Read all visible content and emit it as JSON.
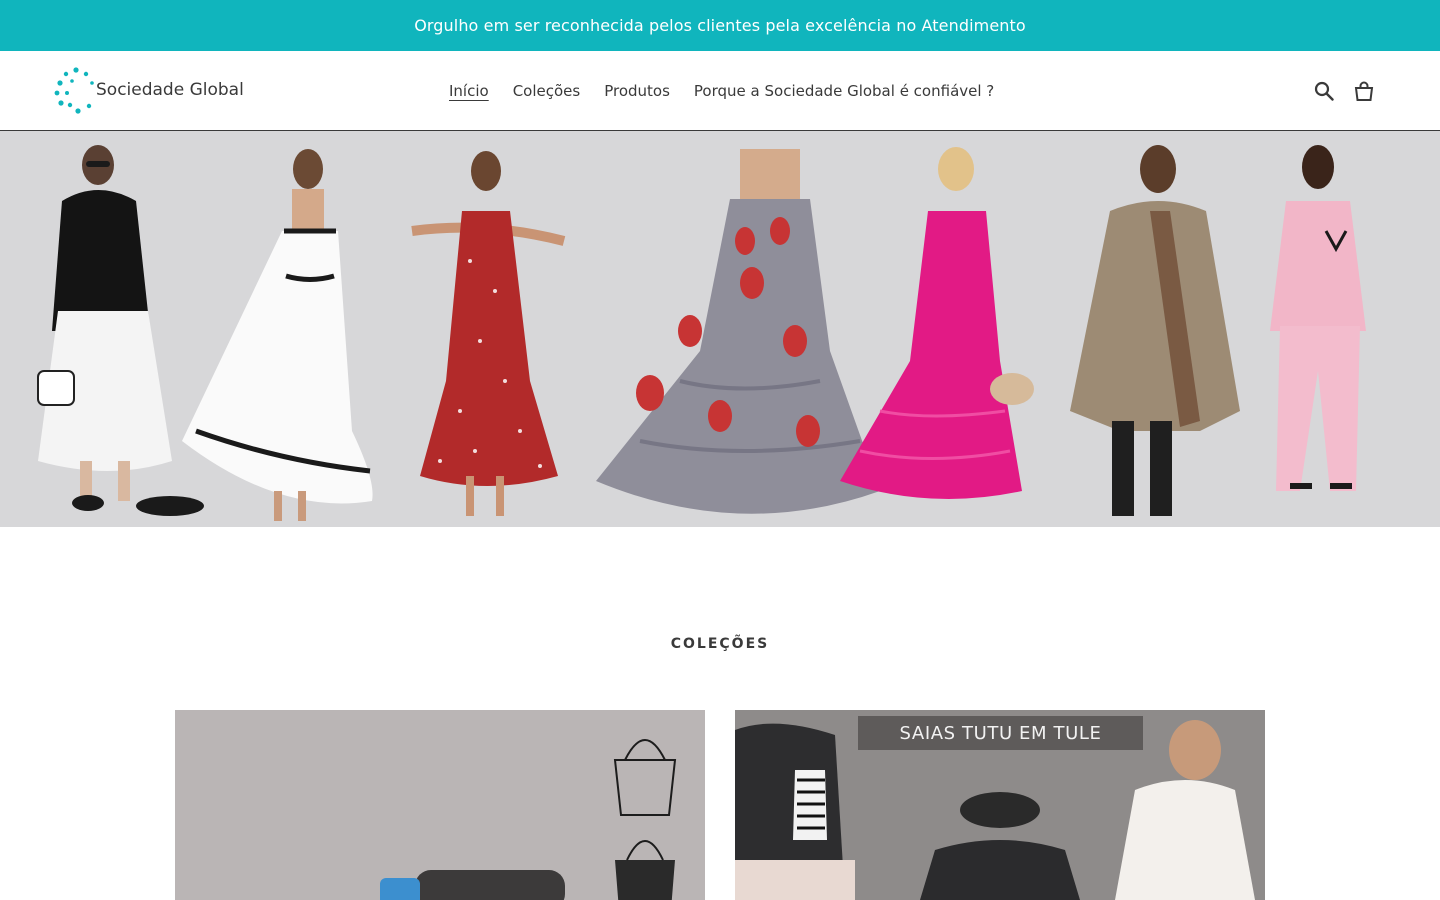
{
  "announcement": {
    "text": "Orgulho em ser reconhecida pelos clientes pela excelência no Atendimento",
    "background": "#10b5bd"
  },
  "header": {
    "logo_text": "Sociedade Global",
    "logo_color": "#10b5bd",
    "nav": [
      {
        "label": "Início",
        "active": true
      },
      {
        "label": "Coleções",
        "active": false
      },
      {
        "label": "Produtos",
        "active": false
      },
      {
        "label": "Porque a Sociedade Global é confiável ?",
        "active": false
      }
    ],
    "icons": [
      "search-icon",
      "cart-icon"
    ]
  },
  "hero": {
    "description_icon": "fashion-models-banner"
  },
  "collections": {
    "title": "COLEÇÕES",
    "cards": [
      {
        "name": "bags-collection"
      },
      {
        "name": "skirts-collection",
        "banner_text": "SAIAS TUTU EM TULE"
      }
    ]
  }
}
